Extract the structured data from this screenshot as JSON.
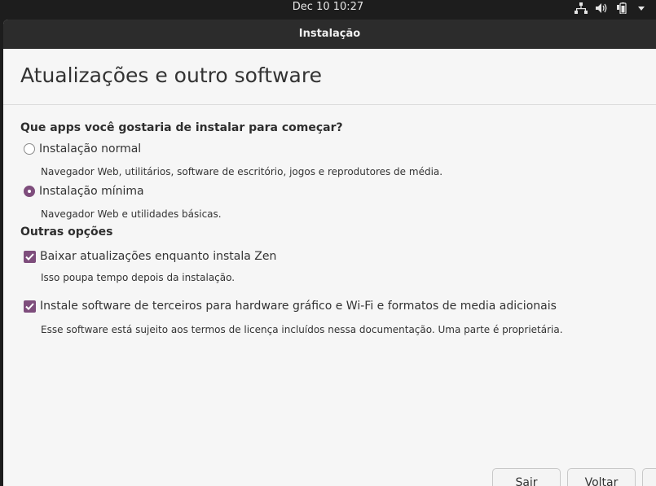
{
  "topbar": {
    "clock": "Dec 10  10:27",
    "icons": [
      "network-icon",
      "volume-icon",
      "battery-icon",
      "system-menu-icon"
    ]
  },
  "window": {
    "title": "Instalação",
    "page_title": "Atualizações e outro software",
    "apps_section": {
      "title": "Que apps você gostaria de instalar para começar?",
      "options": [
        {
          "label": "Instalação normal",
          "description": "Navegador Web, utilitários, software de escritório, jogos e reprodutores de média.",
          "selected": false
        },
        {
          "label": "Instalação mínima",
          "description": "Navegador Web e utilidades básicas.",
          "selected": true
        }
      ]
    },
    "other_section": {
      "title": "Outras opções",
      "options": [
        {
          "label": "Baixar atualizações enquanto instala Zen",
          "description": "Isso poupa tempo depois da instalação.",
          "checked": true
        },
        {
          "label": "Instale software de terceiros para hardware gráfico e Wi-Fi e formatos de media adicionais",
          "description": "Esse software está sujeito aos termos de licença incluídos nessa documentação. Uma parte é proprietária.",
          "checked": true
        }
      ]
    },
    "buttons": {
      "quit": "Sair",
      "back": "Voltar",
      "next": ""
    },
    "accent_color": "#7e4d7c"
  }
}
